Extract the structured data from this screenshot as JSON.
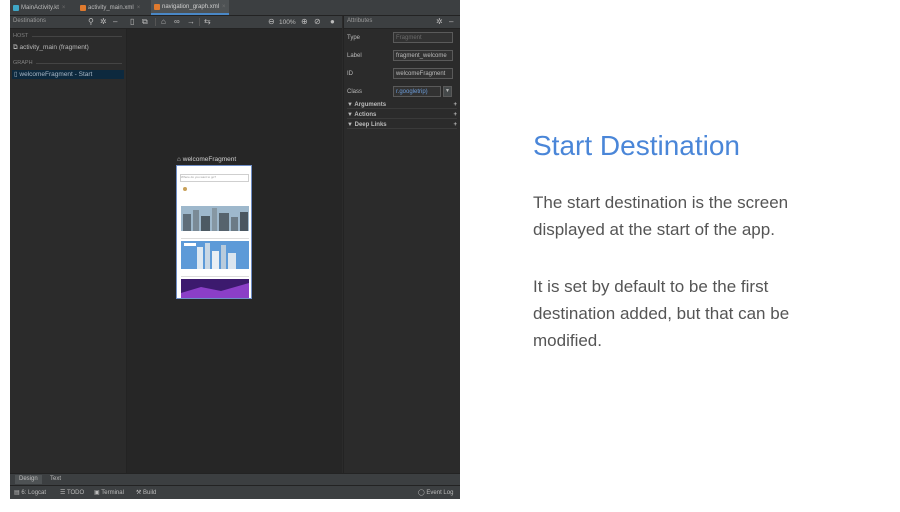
{
  "ide": {
    "tabs": [
      {
        "label": "MainActivity.kt",
        "active": false,
        "icon_color": "#3fa7c7"
      },
      {
        "label": "activity_main.xml",
        "active": false,
        "icon_color": "#e07a2e"
      },
      {
        "label": "navigation_graph.xml",
        "active": true,
        "icon_color": "#e07a2e"
      }
    ],
    "destinations": {
      "title": "Destinations",
      "host_header": "HOST",
      "host_item": "activity_main (fragment)",
      "graph_header": "GRAPH",
      "graph_item": "welcomeFragment - Start"
    },
    "canvas": {
      "zoom": "100%",
      "fragment_label": "welcomeFragment",
      "search_placeholder": "Where do you want to go?"
    },
    "attributes": {
      "title": "Attributes",
      "rows": [
        {
          "label": "Type",
          "value": "Fragment"
        },
        {
          "label": "Label",
          "value": "fragment_welcome"
        },
        {
          "label": "ID",
          "value": "welcomeFragment"
        },
        {
          "label": "Class",
          "value": "r.googletrip)"
        }
      ],
      "groups": [
        "Arguments",
        "Actions",
        "Deep Links"
      ]
    },
    "bottom_tabs": [
      "Design",
      "Text"
    ],
    "status_items": [
      "6: Logcat",
      "TODO",
      "Terminal",
      "Build"
    ],
    "event_log": "Event Log",
    "accent": "#4a88c7"
  },
  "slide": {
    "title": "Start Destination",
    "para1": "The start destination is the screen displayed at the start of the app.",
    "para2": "It is set by default to be the first destination added, but that can be modified.",
    "title_color": "#4a86d8"
  }
}
